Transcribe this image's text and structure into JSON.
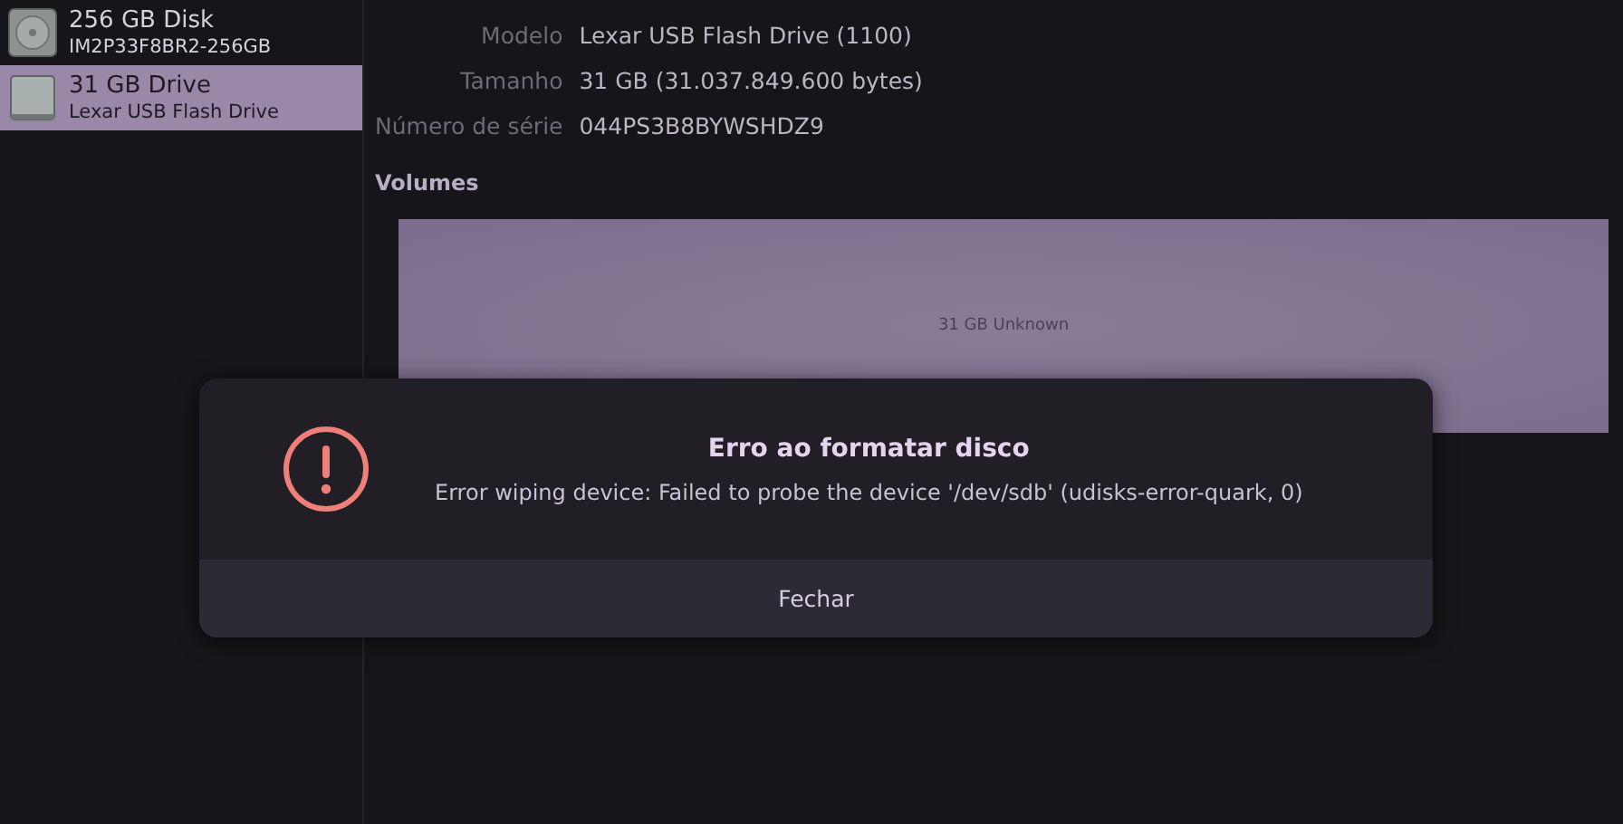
{
  "sidebar": {
    "items": [
      {
        "kind": "disk",
        "title": "256 GB Disk",
        "subtitle": "IM2P33F8BR2-256GB",
        "selected": false
      },
      {
        "kind": "drive",
        "title": "31 GB Drive",
        "subtitle": "Lexar USB Flash Drive",
        "selected": true
      }
    ]
  },
  "details": [
    {
      "label": "Modelo",
      "value": "Lexar USB Flash Drive (1100)"
    },
    {
      "label": "Tamanho",
      "value": "31 GB (31.037.849.600 bytes)"
    },
    {
      "label": "Número de série",
      "value": "044PS3B8BYWSHDZ9"
    }
  ],
  "volumes": {
    "heading": "Volumes",
    "partitions": [
      {
        "label": "31 GB Unknown"
      }
    ]
  },
  "dialog": {
    "title": "Erro ao formatar disco",
    "message": "Error wiping device: Failed to probe the device '/dev/sdb' (udisks-error-quark, 0)",
    "button": "Fechar"
  }
}
